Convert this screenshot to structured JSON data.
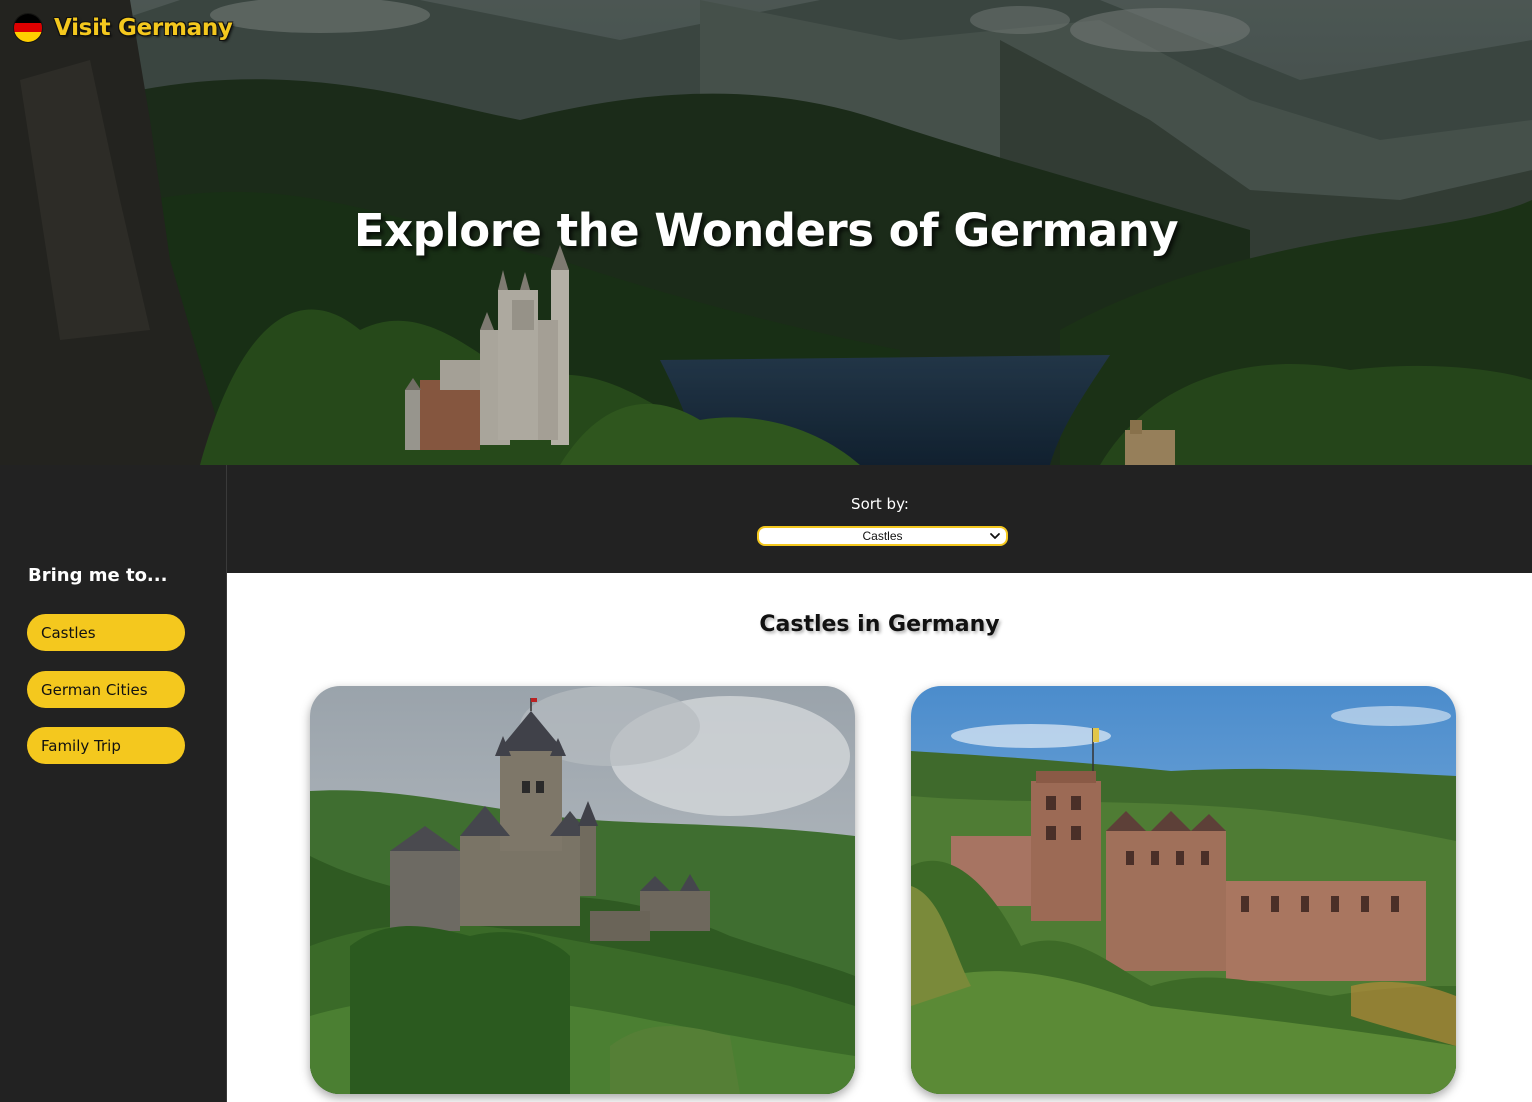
{
  "header": {
    "brand_name": "Visit Germany",
    "logo_icon": "german-flag-icon",
    "flag_colors": [
      "#000000",
      "#dd0000",
      "#ffce00"
    ]
  },
  "hero": {
    "title": "Explore the Wonders of Germany"
  },
  "sidebar": {
    "heading": "Bring me to...",
    "items": [
      {
        "label": "Castles"
      },
      {
        "label": "German Cities"
      },
      {
        "label": "Family Trip"
      }
    ]
  },
  "sort": {
    "label": "Sort by:",
    "selected": "Castles"
  },
  "main": {
    "section_title": "Castles in Germany",
    "cards": [
      {
        "image": "cochem-castle-image"
      },
      {
        "image": "heidelberg-castle-image"
      }
    ]
  },
  "colors": {
    "accent": "#f4c81e",
    "dark": "#222222",
    "content_bg": "#ffffff"
  }
}
